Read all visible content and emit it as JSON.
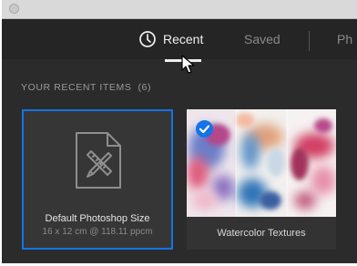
{
  "tabs": {
    "recent": {
      "label": "Recent",
      "icon": "clock-icon",
      "active": true
    },
    "saved": {
      "label": "Saved"
    },
    "more": {
      "label": "Ph"
    }
  },
  "section": {
    "title": "YOUR RECENT ITEMS",
    "count": "(6)"
  },
  "preset_card": {
    "name": "Default Photoshop Size",
    "dimensions": "16 x 12 cm @ 118.11 ppcm",
    "icon": "document-preset-icon",
    "selected": true
  },
  "recent_card": {
    "name": "Watercolor Textures",
    "icon": "checkmark-icon",
    "checked": true
  },
  "colors": {
    "accent": "#1473e6",
    "background": "#2b2b2b",
    "tab_bar": "#252525"
  }
}
